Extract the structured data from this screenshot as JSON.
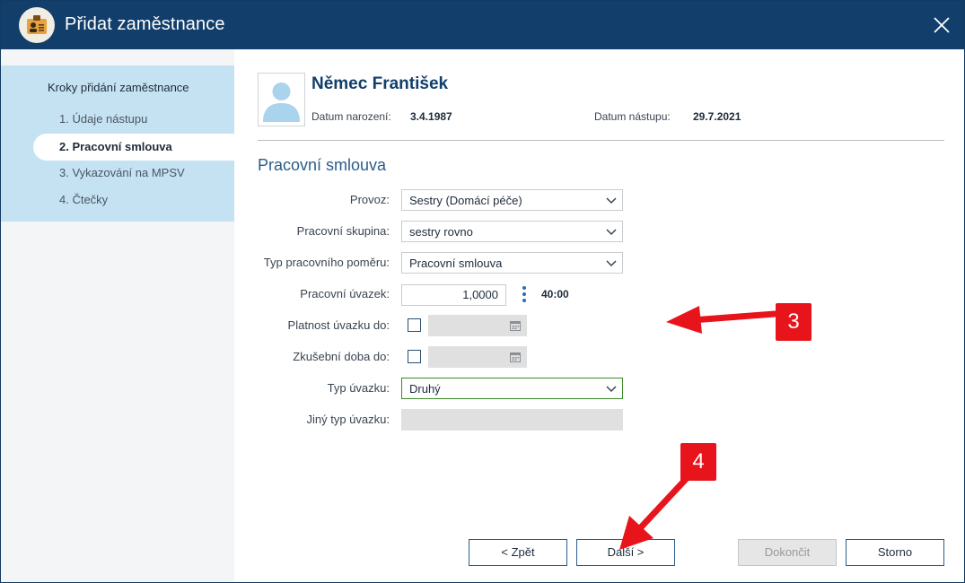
{
  "window": {
    "title": "Přidat zaměstnance"
  },
  "sidebar": {
    "title": "Kroky přidání zaměstnance",
    "steps": [
      {
        "label": "1. Údaje nástupu"
      },
      {
        "label": "2. Pracovní smlouva",
        "active": true
      },
      {
        "label": "3. Vykazování na MPSV"
      },
      {
        "label": "4. Čtečky"
      }
    ]
  },
  "employee": {
    "name": "Němec František",
    "birth_label": "Datum narození:",
    "birth_value": "3.4.1987",
    "start_label": "Datum nástupu:",
    "start_value": "29.7.2021"
  },
  "form": {
    "section_title": "Pracovní smlouva",
    "provoz": {
      "label": "Provoz:",
      "value": "Sestry (Domácí péče)"
    },
    "skupina": {
      "label": "Pracovní skupina:",
      "value": "sestry rovno"
    },
    "typ_pomeru": {
      "label": "Typ pracovního poměru:",
      "value": "Pracovní smlouva"
    },
    "uvazek": {
      "label": "Pracovní úvazek:",
      "value": "1,0000",
      "hours": "40:00"
    },
    "platnost": {
      "label": "Platnost úvazku do:",
      "checked": false
    },
    "zkusebni": {
      "label": "Zkušební doba do:",
      "checked": false
    },
    "typ_uvazku": {
      "label": "Typ úvazku:",
      "value": "Druhý"
    },
    "jiny_typ": {
      "label": "Jiný typ úvazku:",
      "value": ""
    }
  },
  "buttons": {
    "back": "< Zpět",
    "next": "Další >",
    "finish": "Dokončit",
    "cancel": "Storno"
  },
  "annotations": {
    "badge3": "3",
    "badge4": "4",
    "color": "#e8141b"
  },
  "colors": {
    "titlebar": "#123e6b",
    "accent": "#2a5d8c",
    "steps_bg": "#c5e2f2",
    "focus_border": "#3c8a28"
  }
}
